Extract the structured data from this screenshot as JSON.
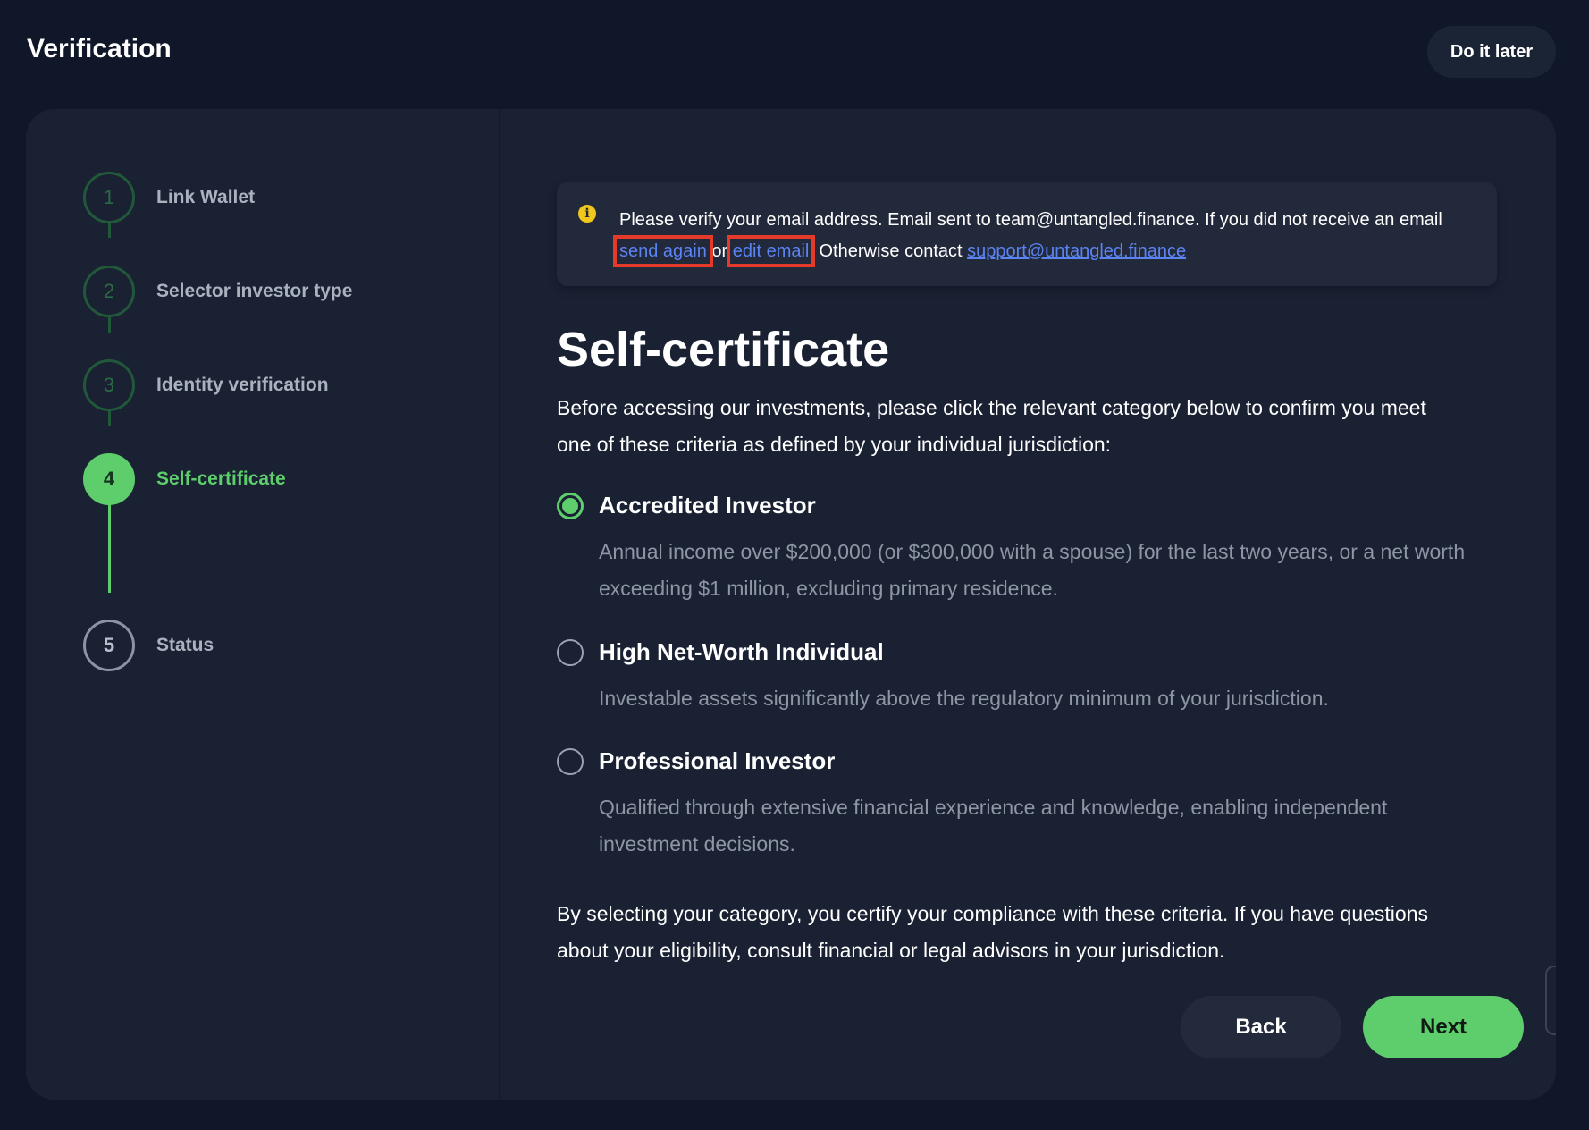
{
  "header": {
    "title": "Verification",
    "do_later_label": "Do it later"
  },
  "steps": [
    {
      "number": "1",
      "label": "Link Wallet",
      "state": "done"
    },
    {
      "number": "2",
      "label": "Selector investor type",
      "state": "done"
    },
    {
      "number": "3",
      "label": "Identity verification",
      "state": "done"
    },
    {
      "number": "4",
      "label": "Self-certificate",
      "state": "active"
    },
    {
      "number": "5",
      "label": "Status",
      "state": "pending"
    }
  ],
  "notice": {
    "text_1": "Please verify your email address. Email sent to team@untangled.finance. If you did not receive an email ",
    "send_again": "send again",
    "text_or": " or ",
    "edit_email": "edit email",
    "text_2": ". Otherwise contact ",
    "support_email": "support@untangled.finance"
  },
  "main": {
    "title": "Self-certificate",
    "intro": "Before accessing our investments, please click the relevant category below to confirm you meet one of these criteria as defined by your individual jurisdiction:",
    "options": [
      {
        "title": "Accredited Investor",
        "desc": "Annual income over $200,000 (or $300,000 with a spouse) for the last two years, or a net worth exceeding $1 million, excluding primary residence.",
        "selected": true
      },
      {
        "title": "High Net-Worth Individual",
        "desc": "Investable assets significantly above the regulatory minimum of your jurisdiction.",
        "selected": false
      },
      {
        "title": "Professional Investor",
        "desc": "Qualified through extensive financial experience and knowledge, enabling independent investment decisions.",
        "selected": false
      }
    ],
    "footer": "By selecting your category, you certify your compliance with these criteria. If you have questions about your eligibility, consult financial or legal advisors in your jurisdiction.",
    "back_label": "Back",
    "next_label": "Next"
  },
  "colors": {
    "accent": "#5ecd6b",
    "link": "#5c83f2",
    "highlight_box": "#e33a29",
    "background": "#0f1728",
    "card": "#192133"
  }
}
